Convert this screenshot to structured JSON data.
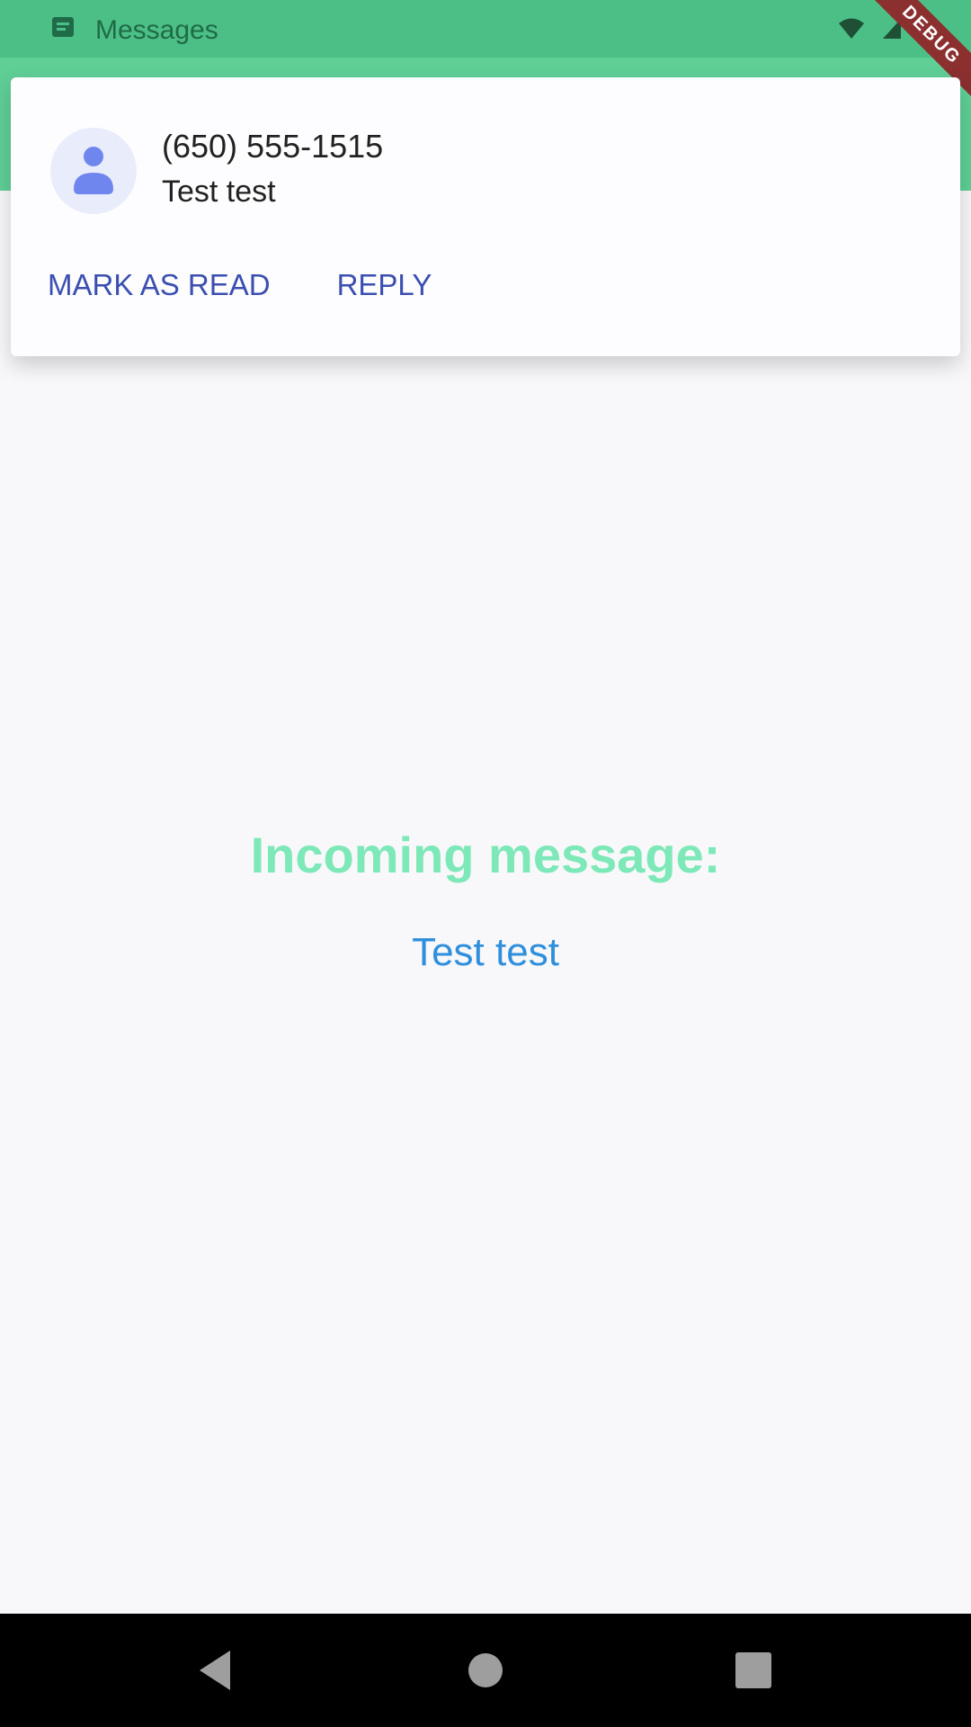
{
  "statusbar": {
    "app_label": "Messages",
    "debug_label": "DEBUG"
  },
  "notification": {
    "sender": "(650) 555-1515",
    "body": "Test test",
    "actions": [
      {
        "label": "MARK AS READ"
      },
      {
        "label": "REPLY"
      }
    ]
  },
  "main": {
    "title": "Incoming message:",
    "message": "Test test"
  },
  "icons": {
    "app": "message-icon",
    "wifi": "wifi-icon",
    "signal": "signal-icon",
    "battery": "battery-icon",
    "avatar": "person-icon",
    "back": "back-icon",
    "home": "home-icon",
    "recents": "recents-icon"
  },
  "colors": {
    "app_bar": "#5fcf96",
    "title": "#7de8b8",
    "message": "#2f8fdc",
    "action": "#3b4fb0"
  }
}
